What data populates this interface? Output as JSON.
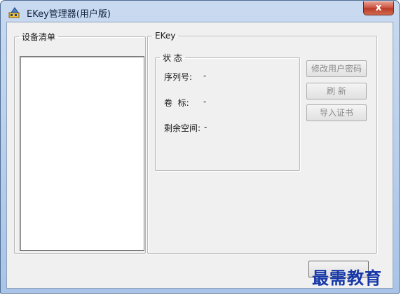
{
  "window": {
    "title": "EKey管理器(用户版)",
    "close_label": "x"
  },
  "device_group": {
    "legend": "设备清单"
  },
  "ekey_group": {
    "legend": "EKey",
    "status": {
      "legend": "状 态",
      "serial_label": "序列号:",
      "serial_value": "-",
      "volume_label": "卷  标:",
      "volume_value": "-",
      "space_label": "剩余空间:",
      "space_value": "-"
    },
    "buttons": {
      "change_password": "修改用户密码",
      "refresh": "刷 新",
      "import_cert": "导入证书"
    }
  },
  "footer": {
    "ok_label": ""
  },
  "watermark": "最需教育",
  "colors": {
    "title_gradient_top": "#c9daf0",
    "close_red": "#c9503d",
    "client_bg": "#f0f0f0",
    "watermark_blue": "#1537a8"
  }
}
